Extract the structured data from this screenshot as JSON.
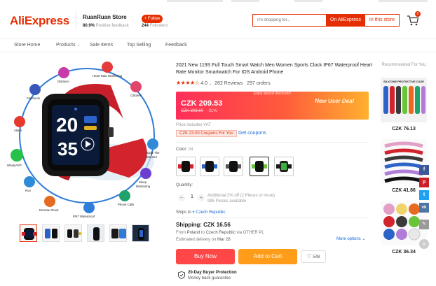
{
  "header": {
    "logo": "AliExpress",
    "store_name": "RuanRuan Store",
    "positive_feedback_value": "80.9%",
    "positive_feedback_label": "Positive feedback",
    "follow_label": "+ Follow",
    "followers_value": "244",
    "followers_label": "Followers",
    "search_placeholder": "I'm shopping for...",
    "search_on_aliexpress": "On AliExpress",
    "search_in_store": "In this store",
    "cart_count": "0"
  },
  "nav": {
    "items": [
      {
        "label": "Store Home"
      },
      {
        "label": "Products"
      },
      {
        "label": "Sale Items"
      },
      {
        "label": "Top Selling"
      },
      {
        "label": "Feedback"
      }
    ]
  },
  "product": {
    "title": "2021 New 119S Full Touch Smart Watch Men Women Sports Clock IP67 Waterproof Heart Rate Monitor Smartwatch For IOS Android Phone",
    "rating": "4.0",
    "reviews": "282 Reviews",
    "orders": "297 orders",
    "promo_label": "Enjoy special discounts!",
    "price": "CZK 209.53",
    "old_price": "CZK 303.60",
    "discount": "-31%",
    "deal_label": "New User Deal",
    "vat_note": "Price includes VAT",
    "coupon_badge": "CZK 23.00 Coupons For You",
    "coupon_link": "Get coupons",
    "color_label": "Color:",
    "color_value": "04",
    "quantity_label": "Quantity:",
    "quantity": "1",
    "qty_note_1": "Additional 2% off (2 Pieces or more)",
    "qty_note_2": "995 Pieces available",
    "ships_to_label": "Ships to",
    "ships_to": "Czech Republic",
    "shipping": "Shipping: CZK 16.56",
    "ship_from_prefix": "From",
    "ship_from": "Poland",
    "ship_to_word": "to",
    "ship_to_country": "Czech Republic",
    "ship_via": "via OTHER PL",
    "delivery_prefix": "Estimated delivery on",
    "delivery_date": "Mar 28",
    "more_options": "More options",
    "buy_now": "Buy Now",
    "add_to_cart": "Add to Cart",
    "wishlist_count": "548",
    "protection_title": "20-Day Buyer Protection",
    "protection_sub": "Money back guarantee"
  },
  "gallery": {
    "watch_time": "20",
    "watch_number": "35",
    "features": [
      "Distance",
      "Heart Rate Monitoring",
      "Calories",
      "Facebook",
      "Alarm",
      "WhatsAPP",
      "Run",
      "Remote Shoot",
      "IP67 Waterproof",
      "Phone Calls",
      "Sleep Monitoring",
      "Raise The Bracelet"
    ]
  },
  "recommended": {
    "title": "Recommended For You",
    "card1_label": "SILICONE PROTECTIVE CASE",
    "prices": [
      "CZK 76.13",
      "CZK 41.86",
      "CZK 36.34"
    ]
  },
  "social": [
    "f",
    "p",
    "t",
    "vk",
    "✎"
  ],
  "colors": {
    "accent": "#e62e04",
    "buy": "#ff4747",
    "cart": "#ff9c1a",
    "link": "#1a6ad9"
  }
}
